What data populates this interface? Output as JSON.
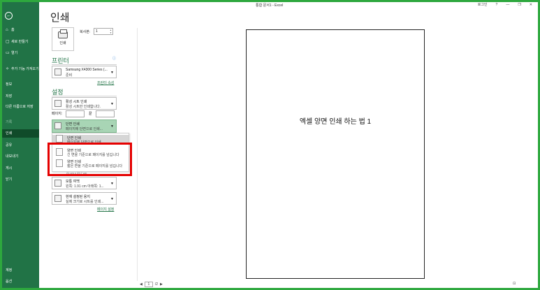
{
  "window": {
    "title": "통합 문서1 - Excel",
    "signin": "로그인",
    "help": "?",
    "minimize": "—",
    "restore": "❐",
    "close": "✕"
  },
  "sidebar": {
    "back": "←",
    "items": [
      {
        "icon": "⌂",
        "label": "홈"
      },
      {
        "icon": "▢",
        "label": "새로 만들기"
      },
      {
        "icon": "▭",
        "label": "열기"
      },
      {
        "icon": "✧",
        "label": "추가 기능 가져오기"
      },
      {
        "label": "정보"
      },
      {
        "label": "저장"
      },
      {
        "label": "다른 이름으로 저장"
      },
      {
        "label": "기록"
      },
      {
        "label": "인쇄"
      },
      {
        "label": "공유"
      },
      {
        "label": "내보내기"
      },
      {
        "label": "게시"
      },
      {
        "label": "닫기"
      },
      {
        "label": "계정"
      },
      {
        "label": "옵션"
      }
    ]
  },
  "print": {
    "heading": "인쇄",
    "print_button": "인쇄",
    "copies_label": "복사본:",
    "copies_value": "1"
  },
  "printer": {
    "section_title": "프린터",
    "name": "Samsung X4300 Series (...",
    "status": "준비",
    "properties_link": "프린터 속성"
  },
  "settings": {
    "section_title": "설정",
    "scope": {
      "line1": "활성 시트 인쇄",
      "line2": "활성 시트만 인쇄합니다."
    },
    "pages_label": "페이지:",
    "to_label": "끝",
    "sides": {
      "line1": "단면 인쇄",
      "line2": "페이지에 단면으로 인쇄..."
    },
    "margins": {
      "line1": "보통 여백",
      "line2": "왼쪽: 1.91 cm 아래쪽: 1..."
    },
    "scaling": {
      "line1": "현재 설정된 용지",
      "line2": "실제 크기로 시트를 인쇄..."
    },
    "page_setup_link": "페이지 설정"
  },
  "sides_menu": {
    "items": [
      {
        "line1": "단면 인쇄",
        "line2": "페이지에 단면으로 인쇄"
      },
      {
        "line1": "양면 인쇄",
        "line2": "긴 면을 기준으로 페이지를 넘깁니다"
      },
      {
        "line1": "양면 인쇄",
        "line2": "짧은 면을 기준으로 페이지를 넘깁니다"
      }
    ],
    "peek": "21 cm x 29.7 cm"
  },
  "preview": {
    "page_text": "엑셀 양면 인쇄 하는 법 1",
    "page_current": "1",
    "page_total": "/2",
    "prev": "◀",
    "next": "▶",
    "zoom": "⊡"
  }
}
